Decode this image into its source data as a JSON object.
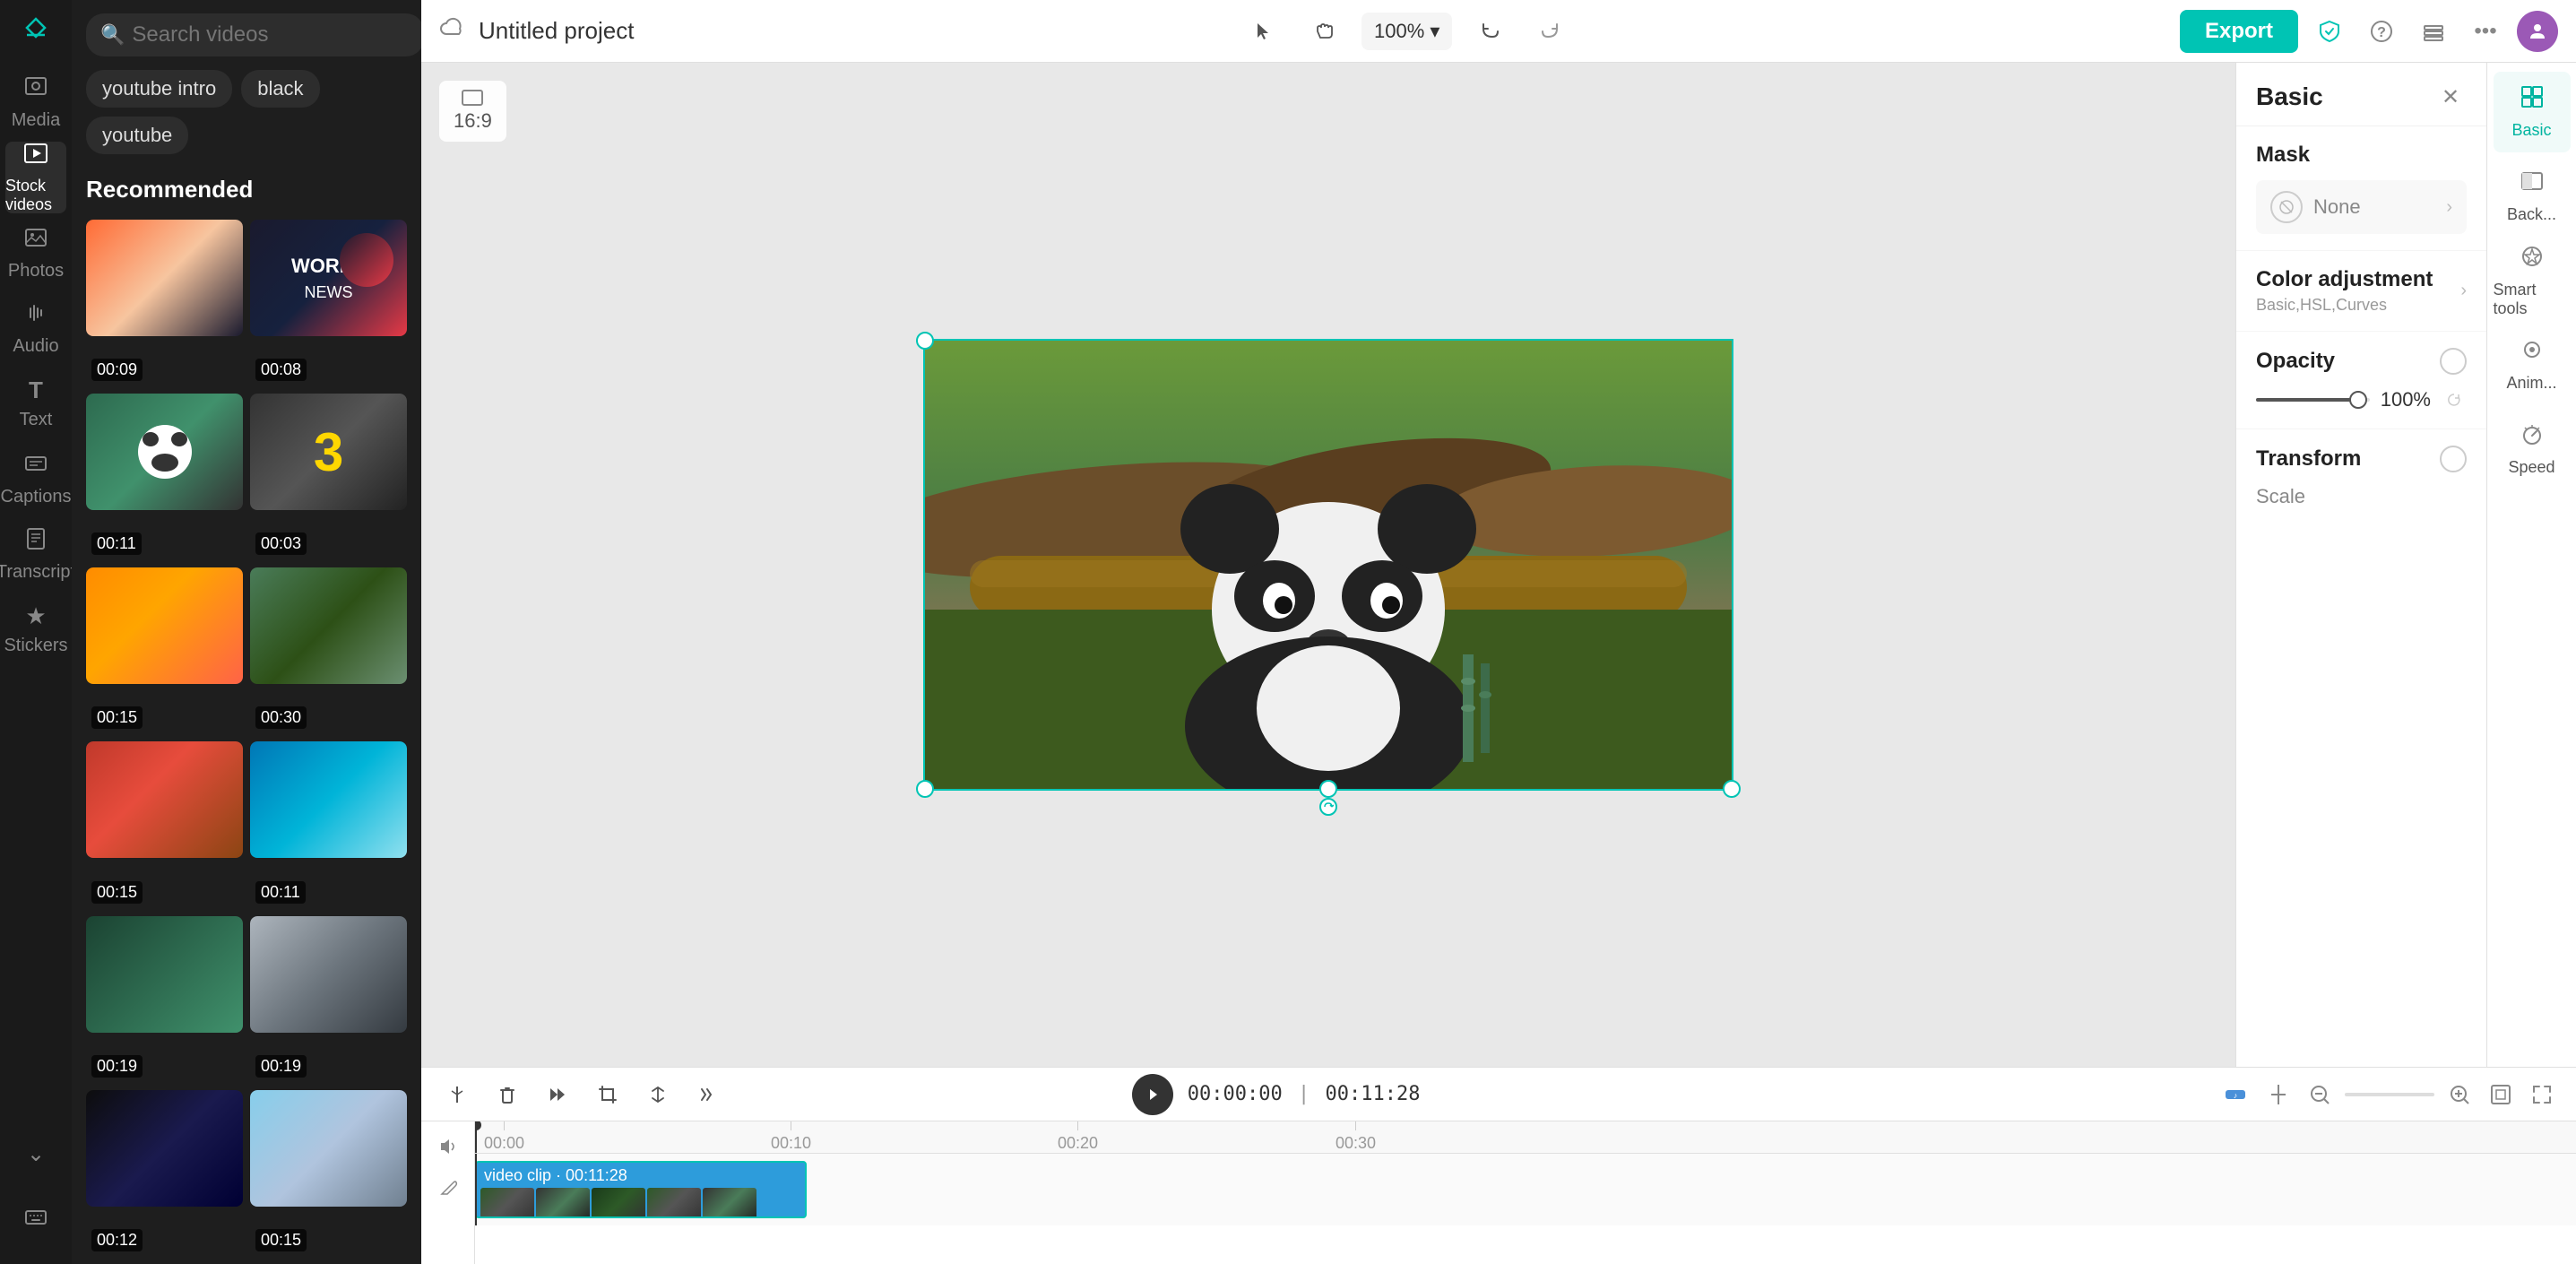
{
  "app": {
    "logo": "✂",
    "title": "Untitled project"
  },
  "left_sidebar": {
    "items": [
      {
        "id": "media",
        "icon": "⊞",
        "label": "Media",
        "active": false
      },
      {
        "id": "stock-videos",
        "icon": "▶",
        "label": "Stock videos",
        "active": true
      },
      {
        "id": "photos",
        "icon": "🖼",
        "label": "Photos",
        "active": false
      },
      {
        "id": "audio",
        "icon": "♪",
        "label": "Audio",
        "active": false
      },
      {
        "id": "text",
        "icon": "T",
        "label": "Text",
        "active": false
      },
      {
        "id": "captions",
        "icon": "≡",
        "label": "Captions",
        "active": false
      },
      {
        "id": "transcript",
        "icon": "📝",
        "label": "Transcript",
        "active": false
      },
      {
        "id": "stickers",
        "icon": "★",
        "label": "Stickers",
        "active": false
      }
    ]
  },
  "media_panel": {
    "search_placeholder": "Search videos",
    "tags": [
      "youtube intro",
      "black",
      "youtube"
    ],
    "section_title": "Recommended",
    "videos": [
      {
        "duration": "00:09",
        "thumb_type": "sunset"
      },
      {
        "duration": "00:08",
        "thumb_type": "news"
      },
      {
        "duration": "00:11",
        "thumb_type": "panda"
      },
      {
        "duration": "00:03",
        "thumb_type": "countdown"
      },
      {
        "duration": "00:15",
        "thumb_type": "sunset2"
      },
      {
        "duration": "00:30",
        "thumb_type": "river"
      },
      {
        "duration": "00:15",
        "thumb_type": "field"
      },
      {
        "duration": "00:11",
        "thumb_type": "beach"
      },
      {
        "duration": "00:19",
        "thumb_type": "forest"
      },
      {
        "duration": "00:19",
        "thumb_type": "walk"
      },
      {
        "duration": "00:12",
        "thumb_type": "stars"
      },
      {
        "duration": "00:15",
        "thumb_type": "clouds"
      }
    ]
  },
  "toolbar": {
    "project_title": "Untitled project",
    "zoom_level": "100%",
    "export_label": "Export",
    "undo_label": "Undo",
    "redo_label": "Redo",
    "cursor_label": "Cursor",
    "hand_label": "Hand"
  },
  "canvas": {
    "aspect_ratio": "16:9"
  },
  "basic_panel": {
    "title": "Basic",
    "mask_label": "Mask",
    "mask_value": "None",
    "color_adj_label": "Color adjustment",
    "color_adj_sub": "Basic,HSL,Curves",
    "opacity_label": "Opacity",
    "opacity_value": "100%",
    "transform_label": "Transform",
    "scale_label": "Scale"
  },
  "right_tools": {
    "items": [
      {
        "id": "basic",
        "icon": "⊞",
        "label": "Basic",
        "active": true
      },
      {
        "id": "background",
        "icon": "◧",
        "label": "Back...",
        "active": false
      },
      {
        "id": "smart-tools",
        "icon": "✦",
        "label": "Smart tools",
        "active": false
      },
      {
        "id": "animation",
        "icon": "◎",
        "label": "Anim...",
        "active": false
      },
      {
        "id": "speed",
        "icon": "⏱",
        "label": "Speed",
        "active": false
      }
    ]
  },
  "timeline": {
    "current_time": "00:00:00",
    "total_time": "00:11:28",
    "clip_label": "video clip",
    "clip_duration": "00:11:28",
    "ruler_marks": [
      "00:00",
      "00:10",
      "00:20",
      "00:30"
    ],
    "tools": [
      {
        "id": "split",
        "icon": "✂"
      },
      {
        "id": "delete",
        "icon": "🗑"
      },
      {
        "id": "play-speed",
        "icon": "▶"
      },
      {
        "id": "crop",
        "icon": "⊡"
      },
      {
        "id": "flip",
        "icon": "⇌"
      },
      {
        "id": "more",
        "icon": "⁂"
      }
    ]
  }
}
